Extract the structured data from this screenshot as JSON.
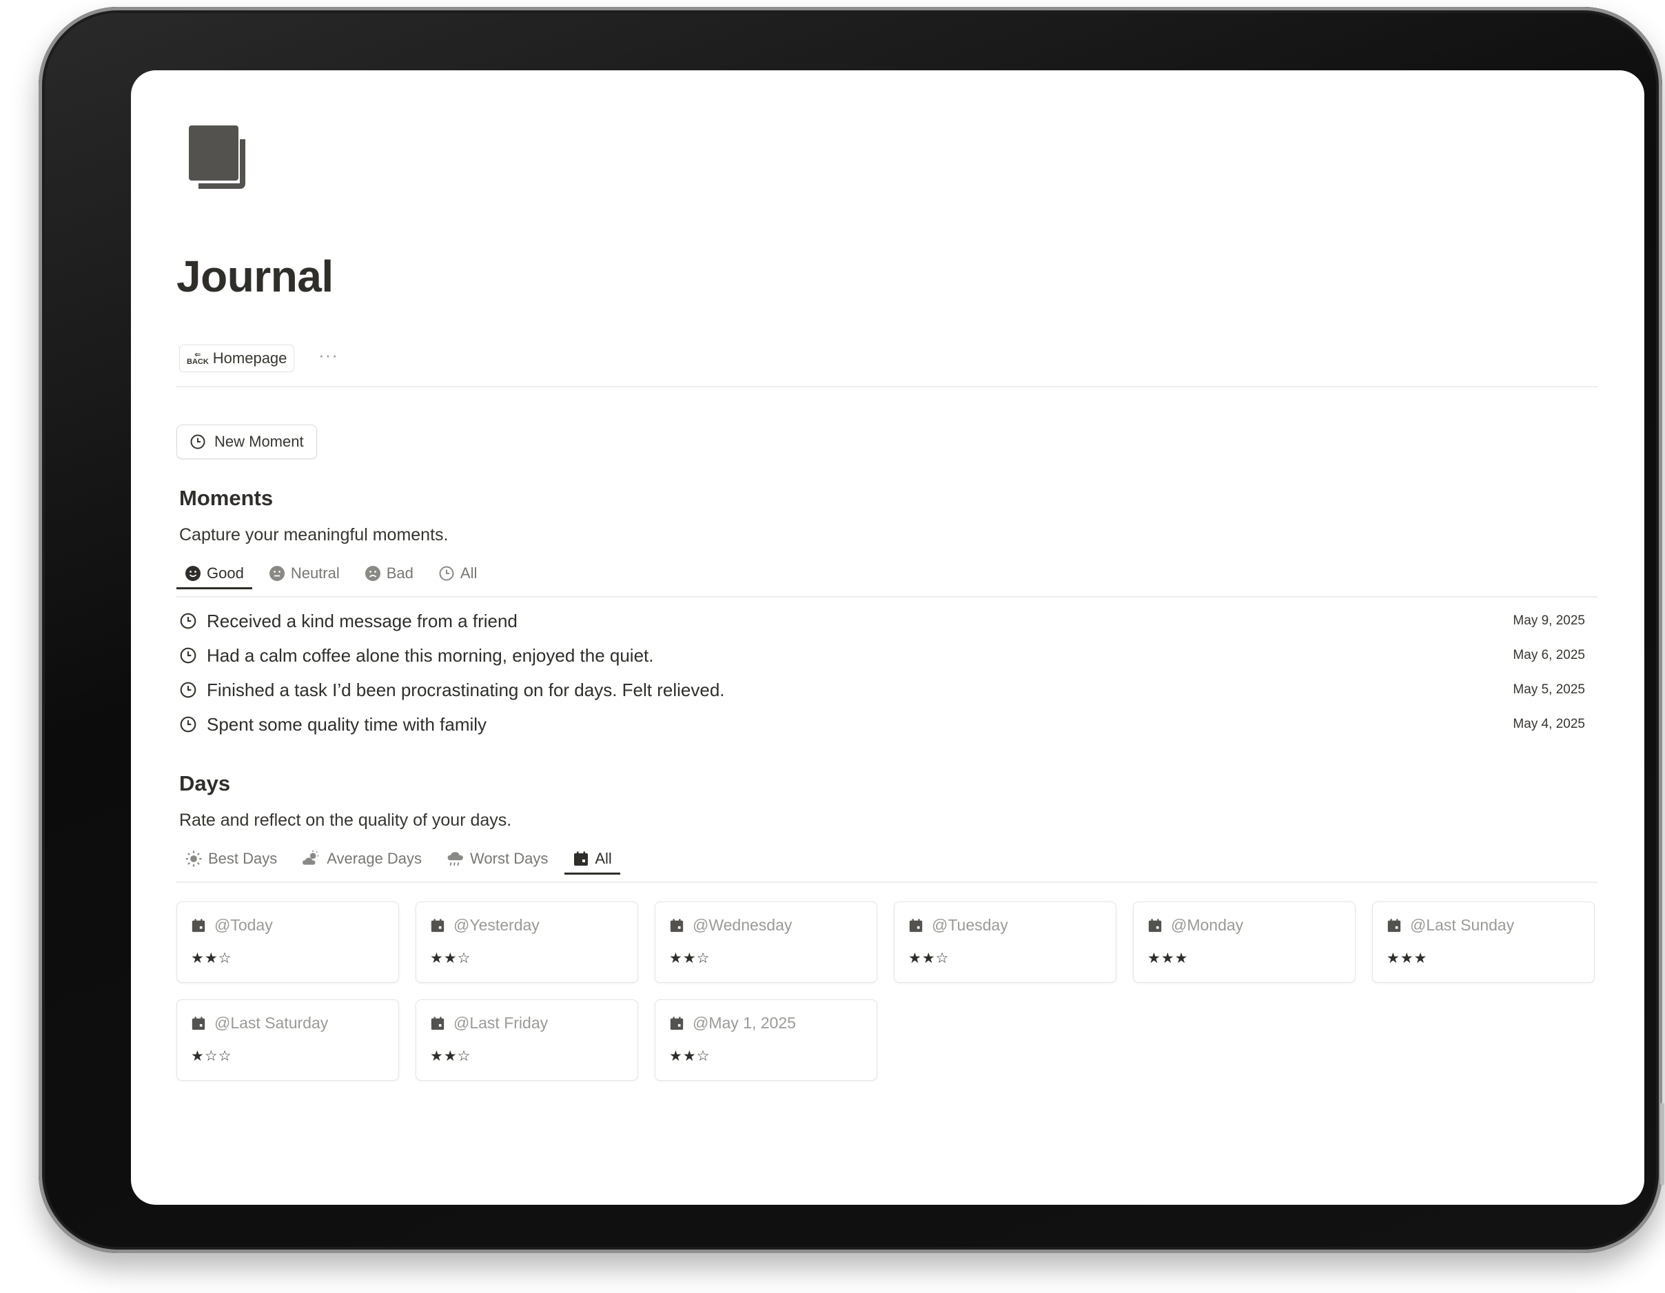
{
  "page": {
    "title": "Journal",
    "backlink_label": "Homepage",
    "more_label": "···"
  },
  "new_moment_button": {
    "label": "New Moment"
  },
  "moments": {
    "heading": "Moments",
    "description": "Capture your meaningful moments.",
    "tabs": [
      {
        "label": "Good",
        "icon": "smile-icon",
        "active": true
      },
      {
        "label": "Neutral",
        "icon": "neutral-face-icon",
        "active": false
      },
      {
        "label": "Bad",
        "icon": "sad-face-icon",
        "active": false
      },
      {
        "label": "All",
        "icon": "clock-icon",
        "active": false
      }
    ],
    "items": [
      {
        "text": "Received a kind message from a friend",
        "date": "May 9, 2025"
      },
      {
        "text": "Had a calm coffee alone this morning, enjoyed the quiet.",
        "date": "May 6, 2025"
      },
      {
        "text": "Finished a task I’d been procrastinating on for days. Felt relieved.",
        "date": "May 5, 2025"
      },
      {
        "text": "Spent some quality time with family",
        "date": "May 4, 2025"
      }
    ]
  },
  "days": {
    "heading": "Days",
    "description": "Rate and reflect on the quality of your days.",
    "tabs": [
      {
        "label": "Best Days",
        "icon": "sun-icon",
        "active": false
      },
      {
        "label": "Average Days",
        "icon": "cloud-sun-icon",
        "active": false
      },
      {
        "label": "Worst Days",
        "icon": "rain-cloud-icon",
        "active": false
      },
      {
        "label": "All",
        "icon": "calendar-icon",
        "active": true
      }
    ],
    "cards": [
      {
        "title": "@Today",
        "stars": "★★☆"
      },
      {
        "title": "@Yesterday",
        "stars": "★★☆"
      },
      {
        "title": "@Wednesday",
        "stars": "★★☆"
      },
      {
        "title": "@Tuesday",
        "stars": "★★☆"
      },
      {
        "title": "@Monday",
        "stars": "★★★"
      },
      {
        "title": "@Last Sunday",
        "stars": "★★★"
      },
      {
        "title": "@Last Saturday",
        "stars": "★☆☆"
      },
      {
        "title": "@Last Friday",
        "stars": "★★☆"
      },
      {
        "title": "@May 1, 2025",
        "stars": "★★☆"
      }
    ]
  },
  "colors": {
    "text": "#37352f",
    "muted": "#9b9a97",
    "border": "#e6e5e2"
  }
}
